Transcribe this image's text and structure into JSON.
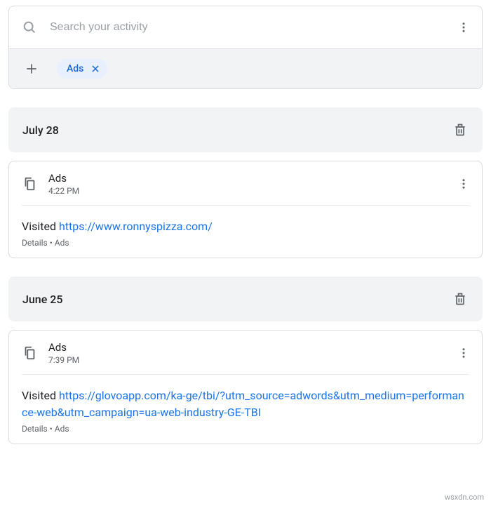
{
  "search": {
    "placeholder": "Search your activity"
  },
  "filter_chip": {
    "label": "Ads"
  },
  "groups": [
    {
      "date": "July 28",
      "entries": [
        {
          "source": "Ads",
          "time": "4:22 PM",
          "action": "Visited",
          "url": "https://www.ronnyspizza.com/",
          "details": "Details",
          "category": "Ads"
        }
      ]
    },
    {
      "date": "June 25",
      "entries": [
        {
          "source": "Ads",
          "time": "7:39 PM",
          "action": "Visited",
          "url": "https://glovoapp.com/ka-ge/tbi/?utm_source=adwords&utm_medium=performance-web&utm_campaign=ua-web-industry-GE-TBI",
          "details": "Details",
          "category": "Ads"
        }
      ]
    }
  ],
  "watermark": "wsxdn.com"
}
